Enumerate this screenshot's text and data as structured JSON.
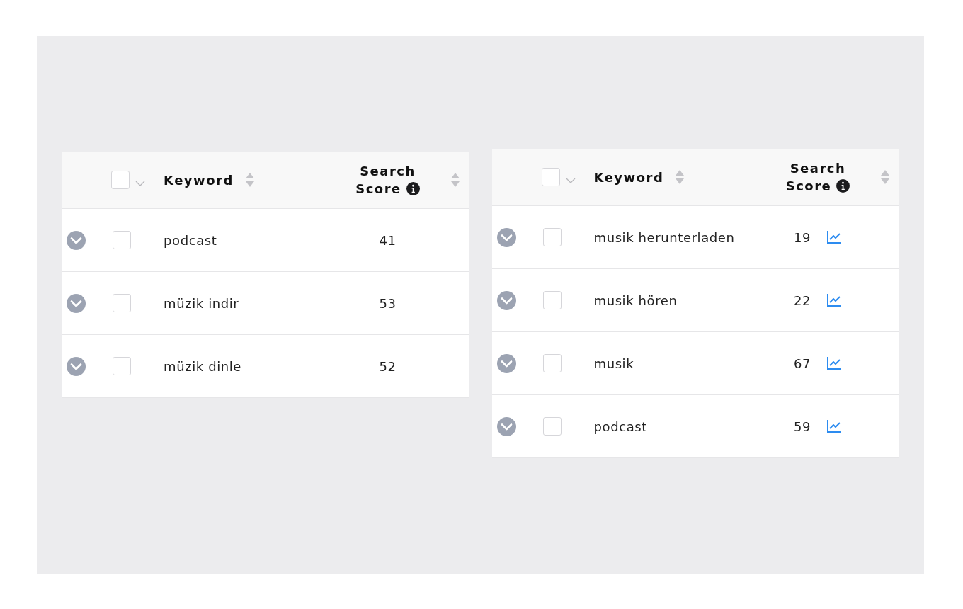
{
  "tables": [
    {
      "trend_icons": false,
      "header": {
        "select_all_checked": false,
        "keyword": "Keyword",
        "score_line1": "Search",
        "score_line2": "Score"
      },
      "rows": [
        {
          "expanded": false,
          "checked": false,
          "keyword": "podcast",
          "score": "41"
        },
        {
          "expanded": false,
          "checked": false,
          "keyword": "müzik indir",
          "score": "53"
        },
        {
          "expanded": false,
          "checked": false,
          "keyword": "müzik dinle",
          "score": "52"
        }
      ]
    },
    {
      "trend_icons": true,
      "header": {
        "select_all_checked": false,
        "keyword": "Keyword",
        "score_line1": "Search",
        "score_line2": "Score"
      },
      "rows": [
        {
          "expanded": false,
          "checked": false,
          "keyword": "musik herunterladen",
          "score": "19"
        },
        {
          "expanded": false,
          "checked": false,
          "keyword": "musik hören",
          "score": "22"
        },
        {
          "expanded": false,
          "checked": false,
          "keyword": "musik",
          "score": "67"
        },
        {
          "expanded": false,
          "checked": false,
          "keyword": "podcast",
          "score": "59"
        }
      ]
    }
  ]
}
